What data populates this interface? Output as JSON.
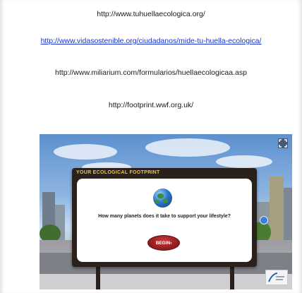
{
  "links": [
    {
      "text": "http://www.tuhuellaecologica.org/",
      "highlighted": false
    },
    {
      "text": "http://www.vidasostenible.org/ciudadanos/mide-tu-huella-ecologica/",
      "highlighted": true
    },
    {
      "text": "http://www.miliarium.com/formularios/huellaecologicaa.asp",
      "highlighted": false
    },
    {
      "text": "http://footprint.wwf.org.uk/",
      "highlighted": false
    }
  ],
  "game": {
    "board_title": "YOUR ECOLOGICAL FOOTPRINT",
    "question": "How many planets does it take to support your lifestyle?",
    "begin_label": "BEGIN",
    "begin_arrow": "›",
    "icons": [
      "fullscreen-icon",
      "globe-icon",
      "navigation-icon",
      "footprint-network-logo"
    ]
  },
  "colors": {
    "link_highlight": "#1a35c8",
    "board_frame": "#2b211b",
    "board_title": "#f0c24a",
    "begin_button": "#8a1515"
  }
}
